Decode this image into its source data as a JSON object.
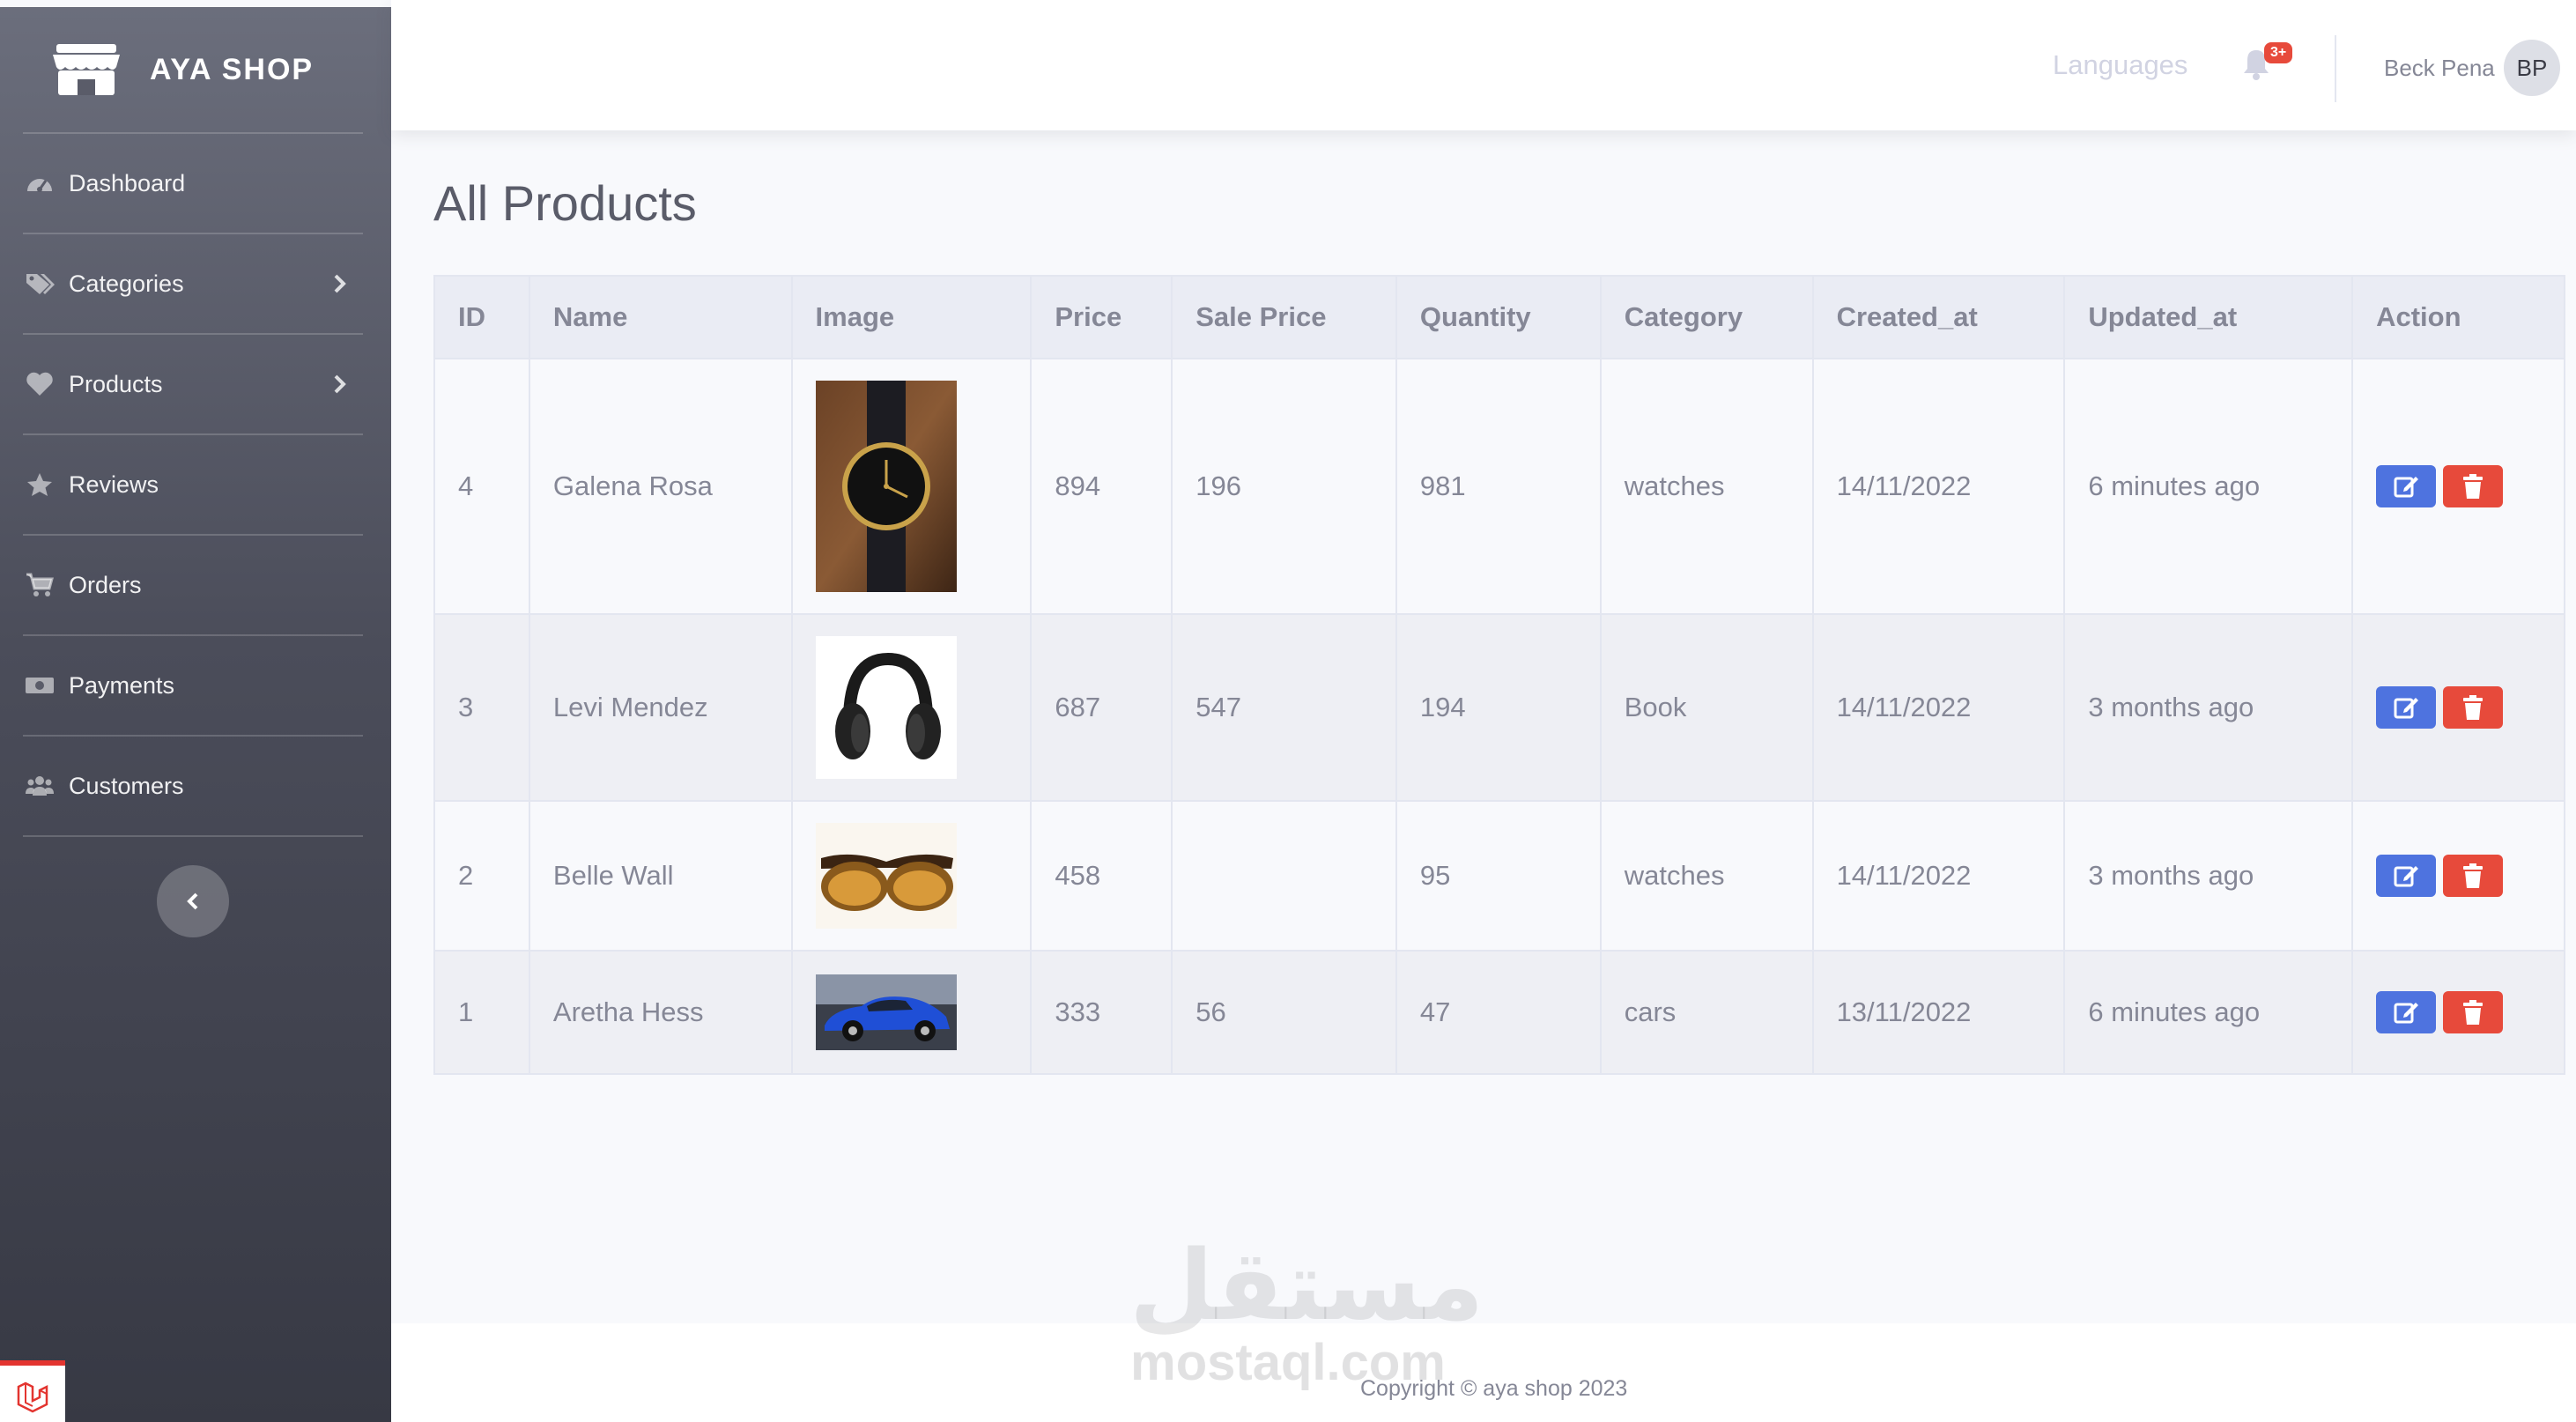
{
  "brand": {
    "name": "AYA SHOP"
  },
  "sidebar": {
    "items": [
      {
        "label": "Dashboard",
        "icon": "dashboard-icon",
        "expandable": false
      },
      {
        "label": "Categories",
        "icon": "tags-icon",
        "expandable": true
      },
      {
        "label": "Products",
        "icon": "heart-icon",
        "expandable": true
      },
      {
        "label": "Reviews",
        "icon": "star-icon",
        "expandable": false
      },
      {
        "label": "Orders",
        "icon": "cart-icon",
        "expandable": false
      },
      {
        "label": "Payments",
        "icon": "money-icon",
        "expandable": false
      },
      {
        "label": "Customers",
        "icon": "users-icon",
        "expandable": false
      }
    ]
  },
  "topbar": {
    "languages_label": "Languages",
    "notification_count": "3+",
    "user_name": "Beck Pena",
    "user_initials": "BP"
  },
  "page": {
    "title": "All Products"
  },
  "table": {
    "columns": [
      "ID",
      "Name",
      "Image",
      "Price",
      "Sale Price",
      "Quantity",
      "Category",
      "Created_at",
      "Updated_at",
      "Action"
    ],
    "rows": [
      {
        "id": "4",
        "name": "Galena Rosa",
        "image": "watch",
        "price": "894",
        "sale_price": "196",
        "quantity": "981",
        "category": "watches",
        "created_at": "14/11/2022",
        "updated_at": "6 minutes ago"
      },
      {
        "id": "3",
        "name": "Levi Mendez",
        "image": "headphones",
        "price": "687",
        "sale_price": "547",
        "quantity": "194",
        "category": "Book",
        "created_at": "14/11/2022",
        "updated_at": "3 months ago"
      },
      {
        "id": "2",
        "name": "Belle Wall",
        "image": "sunglasses",
        "price": "458",
        "sale_price": "",
        "quantity": "95",
        "category": "watches",
        "created_at": "14/11/2022",
        "updated_at": "3 months ago"
      },
      {
        "id": "1",
        "name": "Aretha Hess",
        "image": "car",
        "price": "333",
        "sale_price": "56",
        "quantity": "47",
        "category": "cars",
        "created_at": "13/11/2022",
        "updated_at": "6 minutes ago"
      }
    ]
  },
  "watermark": {
    "arabic": "مستقل",
    "latin": "mostaql.com"
  },
  "footer": {
    "copyright": "Copyright © aya shop 2023"
  },
  "colors": {
    "edit": "#4e73df",
    "delete": "#e74a3b",
    "badge": "#e74a3b"
  }
}
